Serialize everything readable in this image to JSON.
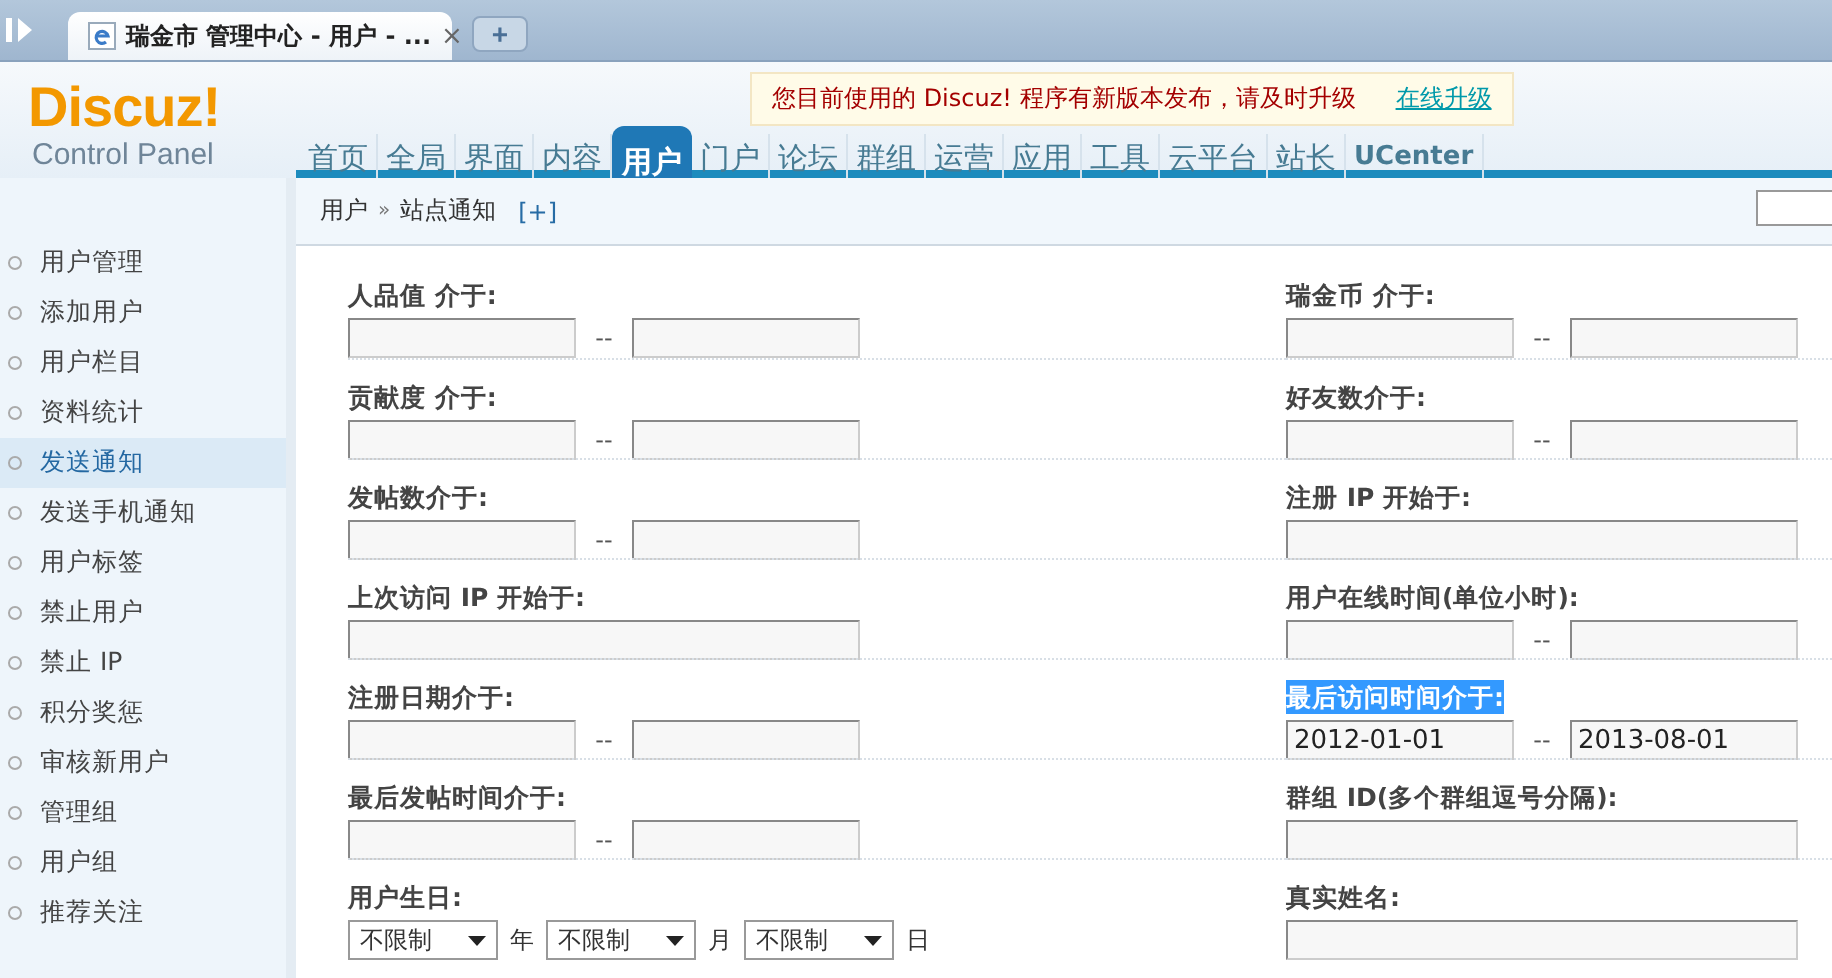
{
  "browser": {
    "tab_title": "瑞金市 管理中心 - 用户 - ...",
    "close": "×",
    "new_tab": "+"
  },
  "notice": {
    "text": "您目前使用的 Discuz! 程序有新版本发布，请及时升级",
    "link": "在线升级"
  },
  "logo": {
    "name": "Discuz!",
    "subtitle": "Control Panel"
  },
  "nav": [
    {
      "label": "首页",
      "selected": false
    },
    {
      "label": "全局",
      "selected": false
    },
    {
      "label": "界面",
      "selected": false
    },
    {
      "label": "内容",
      "selected": false
    },
    {
      "label": "用户",
      "selected": true
    },
    {
      "label": "门户",
      "selected": false
    },
    {
      "label": "论坛",
      "selected": false
    },
    {
      "label": "群组",
      "selected": false
    },
    {
      "label": "运营",
      "selected": false
    },
    {
      "label": "应用",
      "selected": false
    },
    {
      "label": "工具",
      "selected": false
    },
    {
      "label": "云平台",
      "selected": false
    },
    {
      "label": "站长",
      "selected": false
    },
    {
      "label": "UCenter",
      "selected": false
    }
  ],
  "breadcrumb": {
    "section": "用户",
    "separator": "»",
    "page": "站点通知",
    "toggle": "[+]"
  },
  "sidebar": [
    {
      "label": "用户管理",
      "selected": false
    },
    {
      "label": "添加用户",
      "selected": false
    },
    {
      "label": "用户栏目",
      "selected": false
    },
    {
      "label": "资料统计",
      "selected": false
    },
    {
      "label": "发送通知",
      "selected": true
    },
    {
      "label": "发送手机通知",
      "selected": false
    },
    {
      "label": "用户标签",
      "selected": false
    },
    {
      "label": "禁止用户",
      "selected": false
    },
    {
      "label": "禁止 IP",
      "selected": false
    },
    {
      "label": "积分奖惩",
      "selected": false
    },
    {
      "label": "审核新用户",
      "selected": false
    },
    {
      "label": "管理组",
      "selected": false
    },
    {
      "label": "用户组",
      "selected": false
    },
    {
      "label": "推荐关注",
      "selected": false
    }
  ],
  "form": [
    {
      "label": "人品值 介于:",
      "kind": "range",
      "highlighted": false,
      "separator": "--"
    },
    {
      "label": "瑞金币 介于:",
      "kind": "range",
      "highlighted": false,
      "separator": "--"
    },
    {
      "label": "贡献度 介于:",
      "kind": "range",
      "highlighted": false,
      "separator": "--"
    },
    {
      "label": "好友数介于:",
      "kind": "range",
      "highlighted": false,
      "separator": "--"
    },
    {
      "label": "发帖数介于:",
      "kind": "range",
      "highlighted": false,
      "separator": "--"
    },
    {
      "label": "注册 IP 开始于:",
      "kind": "single",
      "highlighted": false
    },
    {
      "label": "上次访问 IP 开始于:",
      "kind": "single",
      "highlighted": false
    },
    {
      "label": "用户在线时间(单位小时):",
      "kind": "range",
      "highlighted": false,
      "separator": "--"
    },
    {
      "label": "注册日期介于:",
      "kind": "range",
      "highlighted": false,
      "separator": "--"
    },
    {
      "label": "最后访问时间介于:",
      "kind": "range",
      "highlighted": true,
      "separator": "--",
      "from": "2012-01-01",
      "to": "2013-08-01"
    },
    {
      "label": "最后发帖时间介于:",
      "kind": "range",
      "highlighted": false,
      "separator": "--"
    },
    {
      "label": "群组 ID(多个群组逗号分隔):",
      "kind": "single",
      "highlighted": false
    },
    {
      "label": "用户生日:",
      "kind": "date",
      "highlighted": false,
      "selects": [
        {
          "value": "不限制",
          "unit": "年"
        },
        {
          "value": "不限制",
          "unit": "月"
        },
        {
          "value": "不限制",
          "unit": "日"
        }
      ]
    },
    {
      "label": "真实姓名:",
      "kind": "single",
      "highlighted": false
    }
  ]
}
